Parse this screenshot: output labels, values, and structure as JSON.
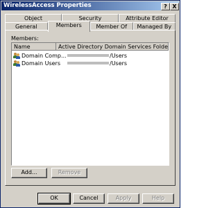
{
  "window": {
    "title": "WirelessAccess Properties"
  },
  "titlebar_buttons": {
    "help": "?",
    "close": "X"
  },
  "tabs_row1": [
    "Object",
    "Security",
    "Attribute Editor"
  ],
  "tabs_row2": [
    "General",
    "Members",
    "Member Of",
    "Managed By"
  ],
  "active_tab": "Members",
  "members": {
    "label": "Members:",
    "columns": [
      "Name",
      "Active Directory Domain Services Folder"
    ],
    "rows": [
      {
        "name": "Domain Comp...",
        "folder": "/Users",
        "icon": "group-icon"
      },
      {
        "name": "Domain Users",
        "folder": "/Users",
        "icon": "group-icon"
      }
    ]
  },
  "panel_buttons": {
    "add": "Add...",
    "remove": "Remove"
  },
  "dialog_buttons": {
    "ok": "OK",
    "cancel": "Cancel",
    "apply": "Apply",
    "help": "Help"
  }
}
